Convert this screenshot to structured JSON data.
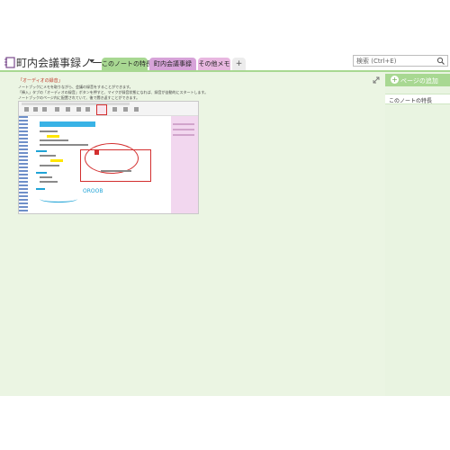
{
  "notebook": {
    "title": "町内会議事録ノート"
  },
  "tabs": [
    {
      "label": "このノートの特長",
      "color": "#a8d892",
      "active": true
    },
    {
      "label": "町内会議事録",
      "color": "#d7a3d9"
    },
    {
      "label": "その他メモ",
      "color": "#e8b7e0"
    },
    {
      "label": "+"
    }
  ],
  "search": {
    "placeholder": "検索 (Ctrl+E)"
  },
  "note": {
    "heading": "「オーディオの録音」",
    "lines": [
      "ノートブックにメモを取りながら、会議の録音をすることができます。",
      "「挿入」タブの「オーディオの録音」ボタンを押すと、マイクが録音状態になれば、録音が自動的にスタートします。",
      "ノートブックのページ内に配置されていて、後で聞き返すことができます。"
    ]
  },
  "screenshot": {
    "handwriting": "OROOB"
  },
  "right_panel": {
    "add_page_label": "ページの追加",
    "pages": [
      {
        "label": "このノートの特長"
      }
    ]
  },
  "colors": {
    "section_green": "#a8d892",
    "page_bg": "#ebf5e3",
    "accent_red": "#c0392b"
  }
}
